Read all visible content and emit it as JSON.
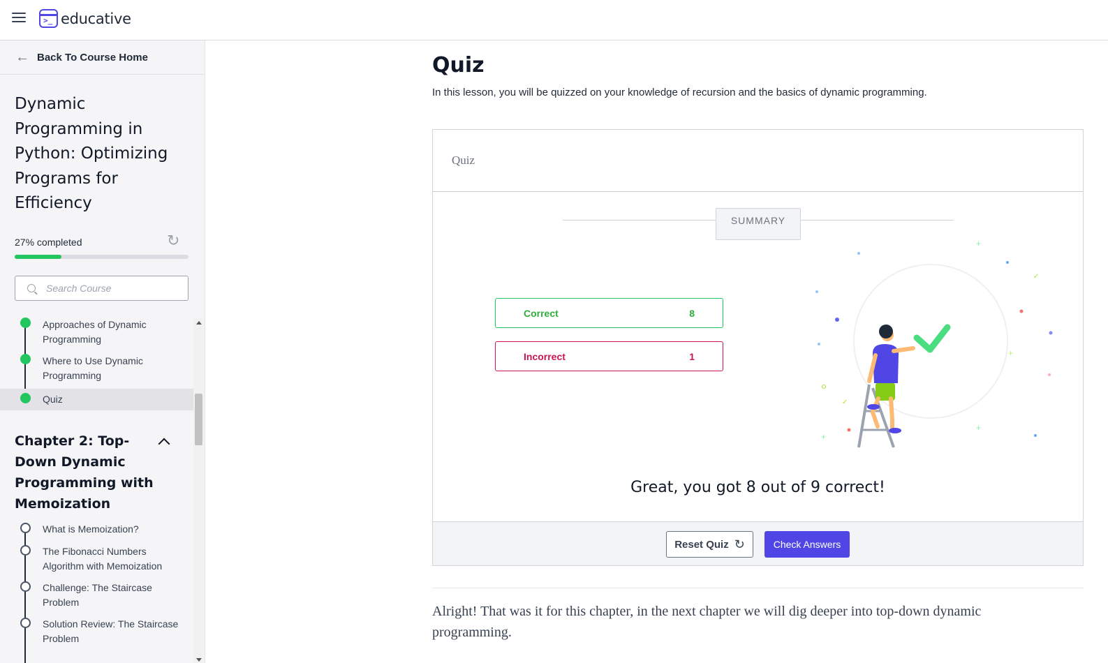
{
  "app": {
    "logo_text": "educative",
    "logo_glyph": ">_"
  },
  "sidebar": {
    "back_label": "Back To Course Home",
    "course_title": "Dynamic Programming in Python: Optimizing Programs for Efficiency",
    "progress": {
      "label": "27% completed",
      "percent": 27
    },
    "search": {
      "placeholder": "Search Course"
    },
    "lessons_ch1": [
      {
        "label": "Approaches of Dynamic Programming",
        "status": "done"
      },
      {
        "label": "Where to Use Dynamic Programming",
        "status": "done"
      },
      {
        "label": "Quiz",
        "status": "done",
        "active": true
      }
    ],
    "chapter2_title": "Chapter 2: Top-Down Dynamic Programming with Memoization",
    "lessons_ch2": [
      {
        "label": "What is Memoization?",
        "status": "todo"
      },
      {
        "label": "The Fibonacci Numbers Algorithm with Memoization",
        "status": "todo"
      },
      {
        "label": "Challenge: The Staircase Problem",
        "status": "todo"
      },
      {
        "label": "Solution Review: The Staircase Problem",
        "status": "todo"
      }
    ]
  },
  "main": {
    "title": "Quiz",
    "description": "In this lesson, you will be quizzed on your knowledge of recursion and the basics of dynamic programming.",
    "quiz": {
      "header": "Quiz",
      "summary_label": "SUMMARY",
      "correct_label": "Correct",
      "correct_count": "8",
      "incorrect_label": "Incorrect",
      "incorrect_count": "1",
      "result_text": "Great, you got 8 out of 9 correct!",
      "reset_label": "Reset Quiz",
      "check_label": "Check Answers"
    },
    "closing_text": "Alright! That was it for this chapter, in the next chapter we will dig deeper into top-down dynamic programming."
  },
  "colors": {
    "brand": "#4f46e5",
    "success": "#22c55e",
    "error": "#c8174d"
  }
}
